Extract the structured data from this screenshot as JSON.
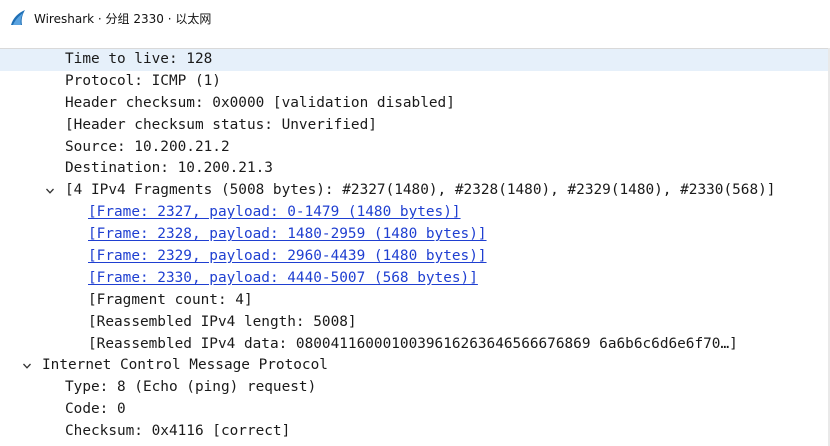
{
  "window": {
    "title": "Wireshark · 分组 2330 · 以太网",
    "icon": "wireshark-fin-icon",
    "accent": "#1f6fb4"
  },
  "tree": {
    "rows": [
      {
        "text": "Time to live: 128",
        "level": 2,
        "selected": true
      },
      {
        "text": "Protocol: ICMP (1)",
        "level": 2
      },
      {
        "text": "Header checksum: 0x0000 [validation disabled]",
        "level": 2
      },
      {
        "text": "[Header checksum status: Unverified]",
        "level": 2
      },
      {
        "text": "Source: 10.200.21.2",
        "level": 2
      },
      {
        "text": "Destination: 10.200.21.3",
        "level": 2
      },
      {
        "text": "[4 IPv4 Fragments (5008 bytes): #2327(1480), #2328(1480), #2329(1480), #2330(568)]",
        "level": 2,
        "expanded": true
      },
      {
        "text": "[Frame: 2327, payload: 0-1479 (1480 bytes)]",
        "level": 3,
        "link": true
      },
      {
        "text": "[Frame: 2328, payload: 1480-2959 (1480 bytes)]",
        "level": 3,
        "link": true
      },
      {
        "text": "[Frame: 2329, payload: 2960-4439 (1480 bytes)]",
        "level": 3,
        "link": true
      },
      {
        "text": "[Frame: 2330, payload: 4440-5007 (568 bytes)]",
        "level": 3,
        "link": true
      },
      {
        "text": "[Fragment count: 4]",
        "level": 3
      },
      {
        "text": "[Reassembled IPv4 length: 5008]",
        "level": 3
      },
      {
        "text": "[Reassembled IPv4 data: 0800411600010039616263646566676869 6a6b6c6d6e6f70…]",
        "level": 3
      },
      {
        "text": "Internet Control Message Protocol",
        "level": 1,
        "expanded": true
      },
      {
        "text": "Type: 8 (Echo (ping) request)",
        "level": 2
      },
      {
        "text": "Code: 0",
        "level": 2
      },
      {
        "text": "Checksum: 0x4116 [correct]",
        "level": 2
      }
    ]
  },
  "colors": {
    "selection": "#e6f0fa",
    "link": "#1f3fd1",
    "text": "#1a1a1a"
  }
}
